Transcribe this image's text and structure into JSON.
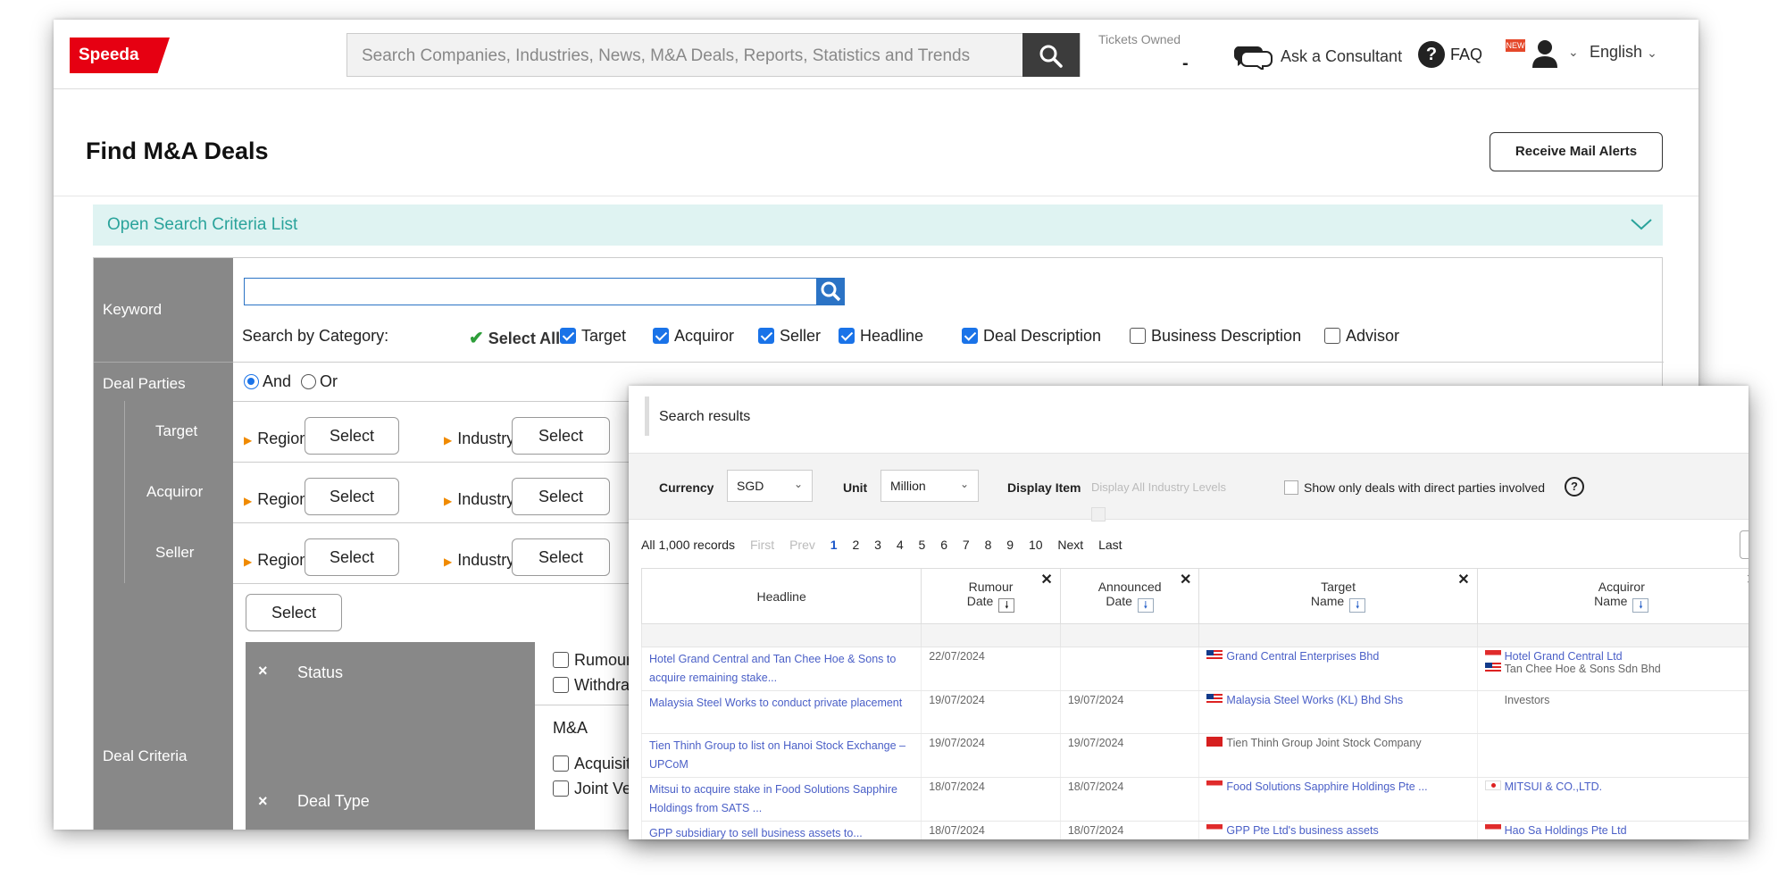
{
  "header": {
    "logo": "Speeda",
    "search_placeholder": "Search Companies, Industries, News, M&A Deals, Reports, Statistics and Trends",
    "tickets_label": "Tickets Owned",
    "tickets_value": "-",
    "consultant": "Ask a Consultant",
    "faq": "FAQ",
    "faq_badge": "NEW",
    "language": "English"
  },
  "page": {
    "title": "Find M&A Deals",
    "mail_button": "Receive Mail Alerts",
    "criteria_bar": "Open Search Criteria List"
  },
  "form": {
    "keyword_label": "Keyword",
    "search_by": "Search by Category:",
    "select_all": "Select All",
    "categories": [
      {
        "label": "Target",
        "checked": true
      },
      {
        "label": "Acquiror",
        "checked": true
      },
      {
        "label": "Seller",
        "checked": true
      },
      {
        "label": "Headline",
        "checked": true
      },
      {
        "label": "Deal Description",
        "checked": true
      },
      {
        "label": "Business Description",
        "checked": false
      },
      {
        "label": "Advisor",
        "checked": false
      }
    ],
    "deal_parties_label": "Deal Parties",
    "and_label": "And",
    "or_label": "Or",
    "parties": [
      "Target",
      "Acquiror",
      "Seller"
    ],
    "region": "Region",
    "industry": "Industry",
    "select": "Select",
    "deal_criteria_label": "Deal Criteria",
    "status_label": "Status",
    "status_options": [
      "Rumour",
      "Withdra"
    ],
    "deal_type_label": "Deal Type",
    "deal_type_group": "M&A",
    "deal_type_options": [
      "Acquisit",
      "Joint Ve"
    ],
    "remove": "×"
  },
  "results": {
    "title": "Search results",
    "currency_label": "Currency",
    "currency_value": "SGD",
    "unit_label": "Unit",
    "unit_value": "Million",
    "display_item_label": "Display Item",
    "industry_levels": "Display All Industry Levels",
    "direct_parties": "Show only deals with direct parties involved",
    "help": "?",
    "pager": {
      "records": "All 1,000 records",
      "first": "First",
      "prev": "Prev",
      "pages": [
        "1",
        "2",
        "3",
        "4",
        "5",
        "6",
        "7",
        "8",
        "9",
        "10"
      ],
      "next": "Next",
      "last": "Last"
    },
    "columns": {
      "headline": "Headline",
      "rumour1": "Rumour",
      "rumour2": "Date",
      "announced1": "Announced",
      "announced2": "Date",
      "target1": "Target",
      "target2": "Name",
      "acquiror1": "Acquiror",
      "acquiror2": "Name"
    },
    "rows": [
      {
        "headline": "Hotel Grand Central and Tan Chee Hoe & Sons to acquire remaining stake...",
        "rumour": "22/07/2024",
        "announced": "",
        "target": "Grand Central Enterprises Bhd",
        "target_flag": "my",
        "acquiror": "Hotel Grand Central Ltd",
        "acquiror_flag": "sg",
        "acquiror2": "Tan Chee Hoe & Sons Sdn Bhd",
        "acquiror2_flag": "my"
      },
      {
        "headline": "Malaysia Steel Works to conduct private placement",
        "rumour": "19/07/2024",
        "announced": "19/07/2024",
        "target": "Malaysia Steel Works (KL) Bhd Shs",
        "target_flag": "my",
        "acquiror": "Investors",
        "acquiror_flag": "",
        "acquiror2": "",
        "acquiror2_flag": ""
      },
      {
        "headline": "Tien Thinh Group to list on Hanoi Stock Exchange – UPCoM",
        "rumour": "19/07/2024",
        "announced": "19/07/2024",
        "target": "Tien Thinh Group Joint Stock Company",
        "target_flag": "vn",
        "acquiror": "",
        "acquiror_flag": "",
        "acquiror2": "",
        "acquiror2_flag": ""
      },
      {
        "headline": "Mitsui to acquire stake in Food Solutions Sapphire Holdings from SATS ...",
        "rumour": "18/07/2024",
        "announced": "18/07/2024",
        "target": "Food Solutions Sapphire Holdings Pte ...",
        "target_flag": "sg",
        "acquiror": "MITSUI & CO.,LTD.",
        "acquiror_flag": "jp",
        "acquiror2": "",
        "acquiror2_flag": ""
      },
      {
        "headline": "GPP subsidiary to sell business assets to...",
        "rumour": "18/07/2024",
        "announced": "18/07/2024",
        "target": "GPP Pte Ltd's business assets",
        "target_flag": "sg",
        "acquiror": "Hao Sa Holdings Pte Ltd",
        "acquiror_flag": "sg",
        "acquiror2": "",
        "acquiror2_flag": ""
      }
    ]
  }
}
